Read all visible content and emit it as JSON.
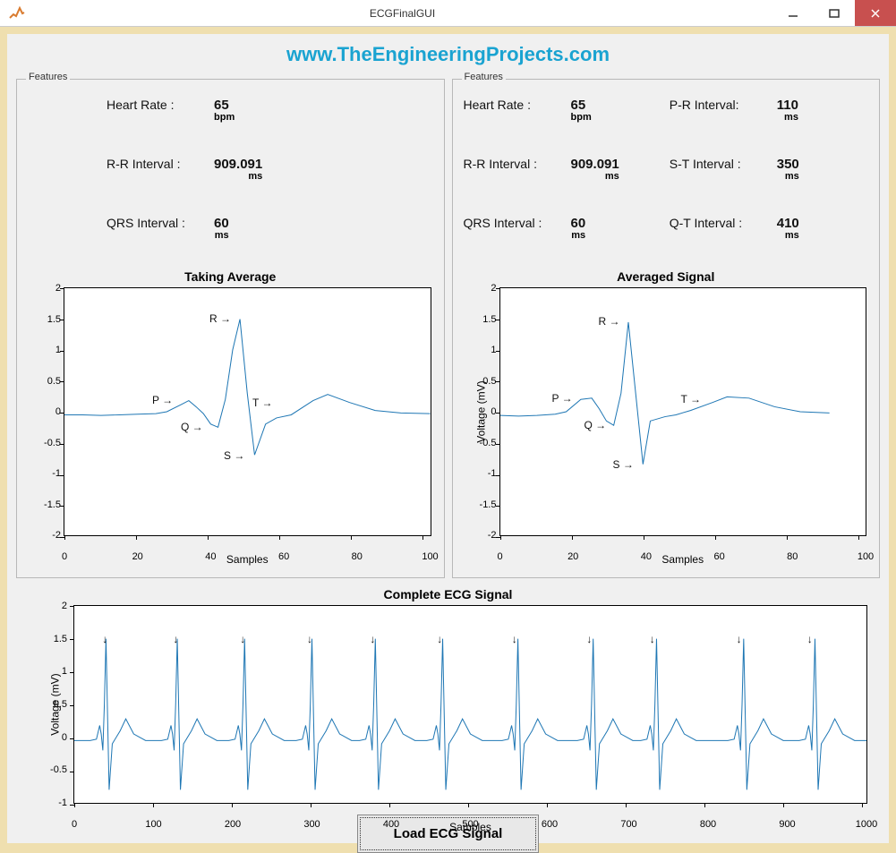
{
  "window": {
    "title": "ECGFinalGUI"
  },
  "url": "www.TheEngineeringProjects.com",
  "panel_label": "Features",
  "load_btn": "Load ECG Signal",
  "left": {
    "hr_label": "Heart Rate :",
    "hr_val": "65",
    "hr_unit": "bpm",
    "rr_label": "R-R Interval :",
    "rr_val": "909.091",
    "rr_unit": "ms",
    "qrs_label": "QRS Interval :",
    "qrs_val": "60",
    "qrs_unit": "ms",
    "chart_title": "Taking Average",
    "xlabel": "Samples"
  },
  "right": {
    "hr_label": "Heart Rate :",
    "hr_val": "65",
    "hr_unit": "bpm",
    "pr_label": "P-R Interval:",
    "pr_val": "110",
    "pr_unit": "ms",
    "rr_label": "R-R Interval :",
    "rr_val": "909.091",
    "rr_unit": "ms",
    "st_label": "S-T Interval :",
    "st_val": "350",
    "st_unit": "ms",
    "qrs_label": "QRS Interval :",
    "qrs_val": "60",
    "qrs_unit": "ms",
    "qt_label": "Q-T Interval :",
    "qt_val": "410",
    "qt_unit": "ms",
    "chart_title": "Averaged Signal",
    "xlabel": "Samples",
    "ylabel": "Voltage (mV)"
  },
  "bottom": {
    "title": "Complete ECG Signal",
    "xlabel": "Samples",
    "ylabel": "Voltage (mV)"
  },
  "pts": {
    "P": "P →",
    "Q": "Q →",
    "R": "R →",
    "S": "S →",
    "T": "T →"
  },
  "chart_data": [
    {
      "type": "line",
      "title": "Taking Average",
      "xlabel": "Samples",
      "ylabel": "",
      "xlim": [
        0,
        100
      ],
      "ylim": [
        -2,
        2
      ],
      "xticks": [
        0,
        20,
        40,
        60,
        80,
        100
      ],
      "yticks": [
        -2,
        -1.5,
        -1,
        -0.5,
        0,
        0.5,
        1,
        1.5,
        2
      ],
      "series": [
        {
          "name": "avg",
          "x": [
            0,
            5,
            10,
            15,
            20,
            25,
            28,
            32,
            34,
            36,
            38,
            40,
            42,
            44,
            46,
            48,
            50,
            52,
            55,
            58,
            62,
            68,
            72,
            78,
            85,
            92,
            100
          ],
          "y": [
            -0.05,
            -0.05,
            -0.06,
            -0.05,
            -0.04,
            -0.03,
            0.0,
            0.12,
            0.18,
            0.08,
            -0.03,
            -0.2,
            -0.25,
            0.2,
            1.0,
            1.5,
            0.3,
            -0.7,
            -0.2,
            -0.1,
            -0.05,
            0.18,
            0.28,
            0.15,
            0.02,
            -0.02,
            -0.03
          ]
        }
      ],
      "annotations": [
        {
          "pt": "P",
          "x": 32,
          "y": 0.18
        },
        {
          "pt": "Q",
          "x": 40,
          "y": -0.25
        },
        {
          "pt": "R",
          "x": 48,
          "y": 1.5
        },
        {
          "pt": "S",
          "x": 52,
          "y": -0.7
        },
        {
          "pt": "T",
          "x": 60,
          "y": 0.15
        }
      ]
    },
    {
      "type": "line",
      "title": "Averaged Signal",
      "xlabel": "Samples",
      "ylabel": "Voltage (mV)",
      "xlim": [
        0,
        100
      ],
      "ylim": [
        -2,
        2
      ],
      "xticks": [
        0,
        20,
        40,
        60,
        80,
        100
      ],
      "yticks": [
        -2,
        -1.5,
        -1,
        -0.5,
        0,
        0.5,
        1,
        1.5,
        2
      ],
      "series": [
        {
          "name": "avg",
          "x": [
            0,
            5,
            10,
            15,
            18,
            22,
            25,
            27,
            29,
            31,
            33,
            35,
            37,
            39,
            41,
            45,
            48,
            52,
            58,
            62,
            68,
            75,
            82,
            90
          ],
          "y": [
            -0.06,
            -0.07,
            -0.06,
            -0.04,
            0.0,
            0.2,
            0.22,
            0.05,
            -0.15,
            -0.22,
            0.3,
            1.45,
            0.3,
            -0.85,
            -0.15,
            -0.08,
            -0.05,
            0.02,
            0.15,
            0.24,
            0.22,
            0.08,
            0.0,
            -0.02
          ]
        }
      ],
      "annotations": [
        {
          "pt": "P",
          "x": 22,
          "y": 0.22
        },
        {
          "pt": "Q",
          "x": 31,
          "y": -0.22
        },
        {
          "pt": "R",
          "x": 35,
          "y": 1.45
        },
        {
          "pt": "S",
          "x": 39,
          "y": -0.85
        },
        {
          "pt": "T",
          "x": 58,
          "y": 0.2
        }
      ]
    },
    {
      "type": "line",
      "title": "Complete ECG Signal",
      "xlabel": "Samples",
      "ylabel": "Voltage (mV)",
      "xlim": [
        0,
        1000
      ],
      "ylim": [
        -1,
        2
      ],
      "xticks": [
        0,
        100,
        200,
        300,
        400,
        500,
        600,
        700,
        800,
        900,
        1000
      ],
      "yticks": [
        -1,
        -0.5,
        0,
        0.5,
        1,
        1.5,
        2
      ],
      "r_peaks_x": [
        40,
        130,
        215,
        300,
        380,
        465,
        560,
        655,
        735,
        845,
        935
      ],
      "series_desc": "Repeating ECG beat pattern with R peaks ~1.5 mV at listed x positions, S troughs ~-0.8 mV, P waves ~0.2 mV before each R, T waves ~0.3 mV after each R; baseline ~-0.05 mV."
    }
  ]
}
